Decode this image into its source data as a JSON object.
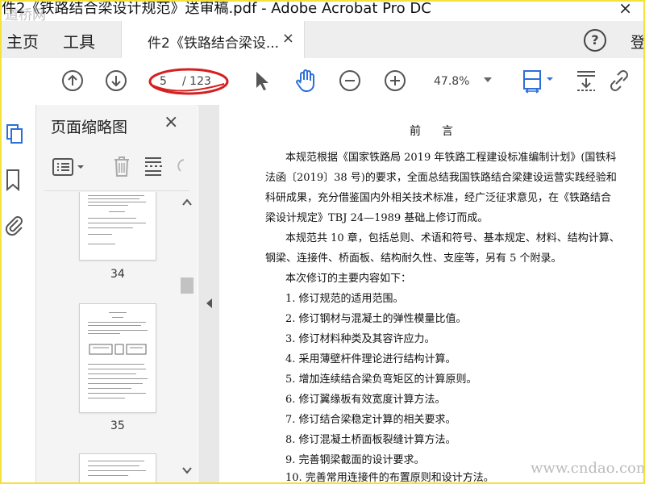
{
  "window": {
    "title": "件2《铁路结合梁设计规范》送审稿.pdf - Adobe Acrobat Pro DC",
    "watermark_top": "道桥网",
    "close_glyph": "×"
  },
  "tabs": {
    "home_label": "主页",
    "tools_label": "工具",
    "doc_tab_label": "件2《铁路结合梁设...",
    "doc_tab_close": "×",
    "help_glyph": "?",
    "sign_in_label": "登"
  },
  "toolbar": {
    "page_current": "5",
    "page_total": "/ 123",
    "zoom": "47.8%"
  },
  "thumbnail_panel": {
    "title": "页面缩略图",
    "close_glyph": "×",
    "pages": [
      {
        "label": "34"
      },
      {
        "label": "35"
      }
    ]
  },
  "document": {
    "heading": "前言",
    "lines": [
      "本规范根据《国家铁路局 2019 年铁路工程建设标准编制计划》(国铁科",
      "法函〔2019〕38 号)的要求，全面总结我国铁路结合梁建设运营实践经验和",
      "科研成果，充分借鉴国内外相关技术标准，经广泛征求意见，在《铁路结合",
      "梁设计规定》TBJ 24—1989 基础上修订而成。",
      "本规范共 10 章，包括总则、术语和符号、基本规定、材料、结构计算、",
      "钢梁、连接件、桥面板、结构耐久性、支座等，另有 5 个附录。",
      "本次修订的主要内容如下：",
      "1. 修订规范的适用范围。",
      "2. 修订钢材与混凝土的弹性模量比值。",
      "3. 修订材料种类及其容许应力。",
      "4. 采用薄壁杆件理论进行结构计算。",
      "5. 增加连续结合梁负弯矩区的计算原则。",
      "6. 修订翼缘板有效宽度计算方法。",
      "7. 修订结合梁稳定计算的相关要求。",
      "8. 修订混凝土桥面板裂缝计算方法。",
      "9. 完善钢梁截面的设计要求。",
      "10. 完善常用连接件的布置原则和设计方法。"
    ]
  },
  "site_watermark": "www.cndao.com",
  "colors": {
    "accent_blue": "#2d6fd6",
    "frame_yellow": "#f2e23a",
    "highlight_red": "#d42020"
  }
}
